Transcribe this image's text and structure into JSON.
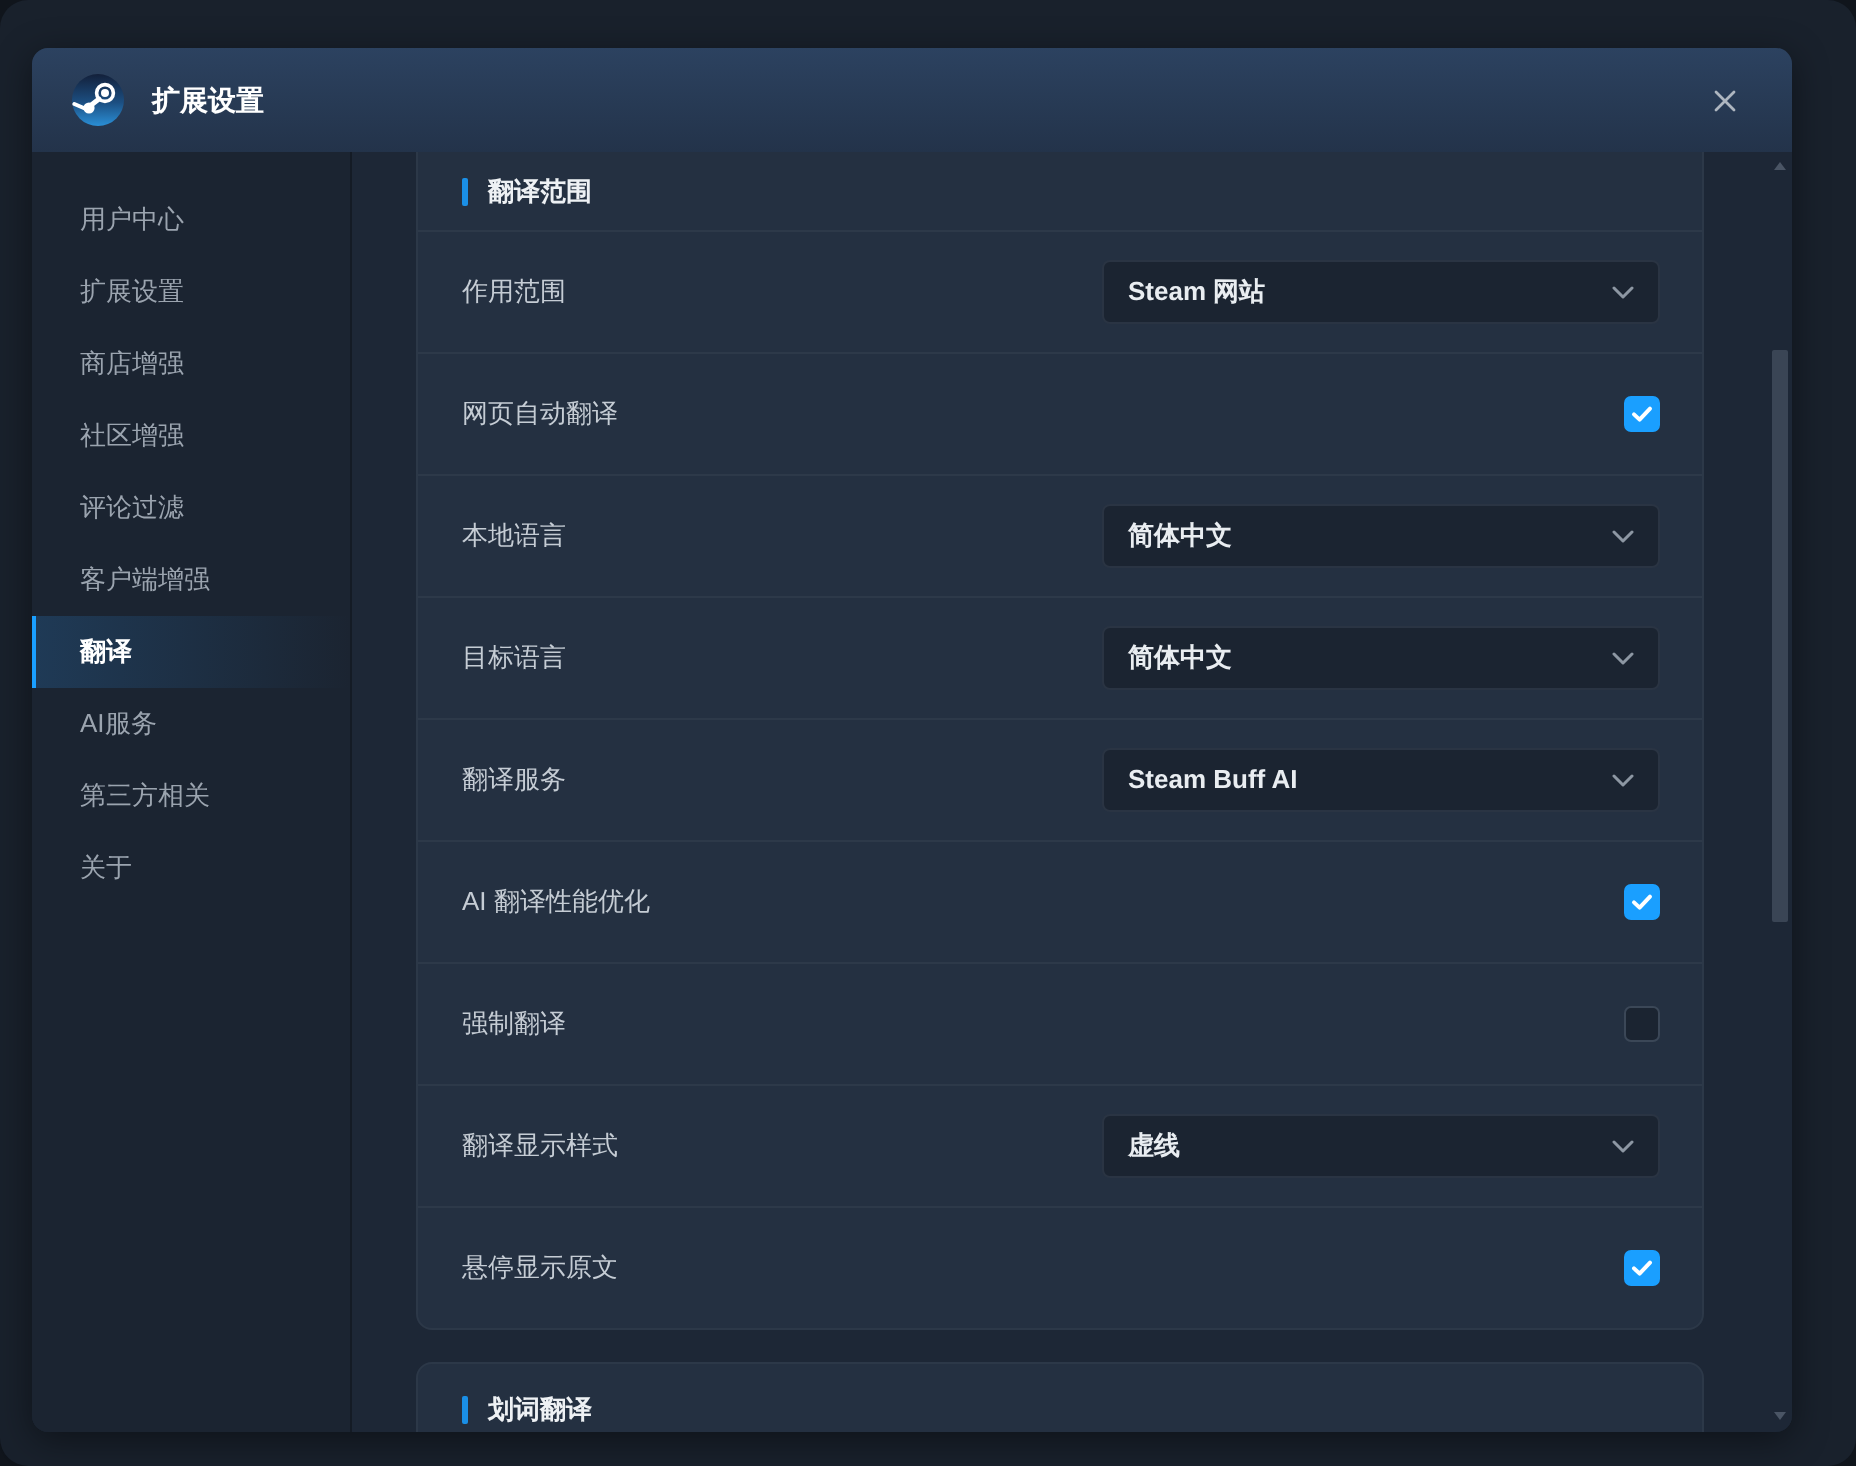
{
  "window": {
    "title": "扩展设置"
  },
  "sidebar": {
    "items": [
      {
        "label": "用户中心",
        "selected": false
      },
      {
        "label": "扩展设置",
        "selected": false
      },
      {
        "label": "商店增强",
        "selected": false
      },
      {
        "label": "社区增强",
        "selected": false
      },
      {
        "label": "评论过滤",
        "selected": false
      },
      {
        "label": "客户端增强",
        "selected": false
      },
      {
        "label": "翻译",
        "selected": true
      },
      {
        "label": "AI服务",
        "selected": false
      },
      {
        "label": "第三方相关",
        "selected": false
      },
      {
        "label": "关于",
        "selected": false
      }
    ]
  },
  "sections": [
    {
      "title": "翻译范围",
      "rows": [
        {
          "kind": "select",
          "label": "作用范围",
          "value": "Steam 网站"
        },
        {
          "kind": "checkbox",
          "label": "网页自动翻译",
          "checked": true
        },
        {
          "kind": "select",
          "label": "本地语言",
          "value": "简体中文"
        },
        {
          "kind": "select",
          "label": "目标语言",
          "value": "简体中文"
        },
        {
          "kind": "select",
          "label": "翻译服务",
          "value": "Steam Buff AI"
        },
        {
          "kind": "checkbox",
          "label": "AI 翻译性能优化",
          "checked": true
        },
        {
          "kind": "checkbox",
          "label": "强制翻译",
          "checked": false
        },
        {
          "kind": "select",
          "label": "翻译显示样式",
          "value": "虚线"
        },
        {
          "kind": "checkbox",
          "label": "悬停显示原文",
          "checked": true
        }
      ]
    },
    {
      "title": "划词翻译"
    }
  ]
}
